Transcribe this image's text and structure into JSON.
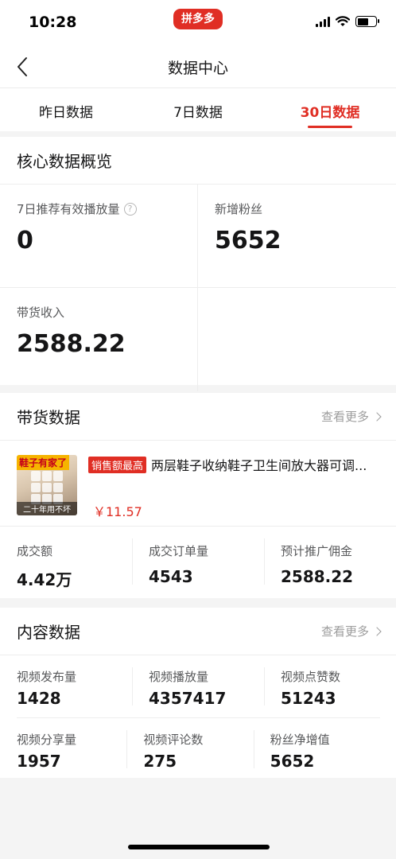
{
  "status_bar": {
    "time": "10:28",
    "brand": "拼多多"
  },
  "nav": {
    "title": "数据中心"
  },
  "tabs": [
    {
      "label": "昨日数据",
      "active": false
    },
    {
      "label": "7日数据",
      "active": false
    },
    {
      "label": "30日数据",
      "active": true
    }
  ],
  "core": {
    "title": "核心数据概览",
    "items": [
      {
        "label": "7日推荐有效播放量",
        "value": "0",
        "help": "?"
      },
      {
        "label": "新增粉丝",
        "value": "5652"
      },
      {
        "label": "带货收入",
        "value": "2588.22"
      }
    ]
  },
  "sales": {
    "title": "带货数据",
    "more": "查看更多",
    "product": {
      "badge": "销售额最高",
      "name": "两层鞋子收纳鞋子卫生间放大器可调...",
      "price": "￥11.57",
      "thumb_top_text": "鞋子有家了",
      "thumb_bottom_text": "二十年用不坏"
    },
    "stats": [
      {
        "label": "成交额",
        "value": "4.42万"
      },
      {
        "label": "成交订单量",
        "value": "4543"
      },
      {
        "label": "预计推广佣金",
        "value": "2588.22"
      }
    ]
  },
  "content": {
    "title": "内容数据",
    "more": "查看更多",
    "stats": [
      {
        "label": "视频发布量",
        "value": "1428"
      },
      {
        "label": "视频播放量",
        "value": "4357417"
      },
      {
        "label": "视频点赞数",
        "value": "51243"
      },
      {
        "label": "视频分享量",
        "value": "1957"
      },
      {
        "label": "视频评论数",
        "value": "275"
      },
      {
        "label": "粉丝净增值",
        "value": "5652"
      }
    ]
  },
  "colors": {
    "accent": "#e02e24",
    "text": "#151516",
    "muted": "#58595b",
    "background": "#f4f4f4"
  }
}
